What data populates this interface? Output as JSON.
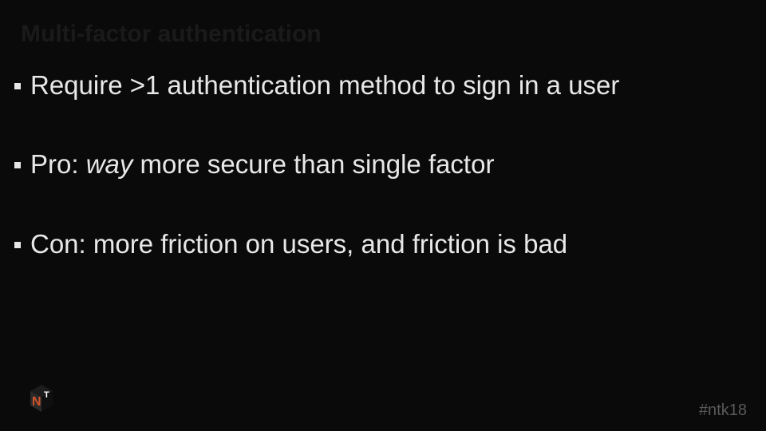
{
  "slide": {
    "title": "Multi-factor authentication",
    "bullets": [
      {
        "text": "Require >1 authentication method to sign in a user"
      },
      {
        "pre": "Pro: ",
        "em": "way",
        "post": " more secure than single factor"
      },
      {
        "text": "Con: more friction on users, and friction is bad"
      }
    ],
    "hashtag": "#ntk18",
    "logo_alt": "NT logo"
  }
}
